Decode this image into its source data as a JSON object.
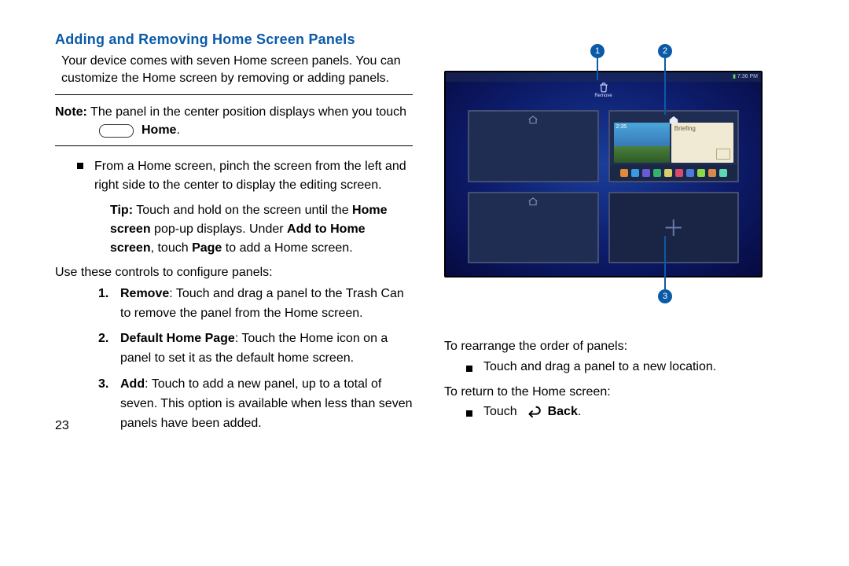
{
  "title": "Adding and Removing Home Screen Panels",
  "intro": "Your device comes with seven Home screen panels. You can customize the Home screen by removing or adding panels.",
  "note_label": "Note:",
  "note_text1": " The panel in the center position displays when you touch",
  "home_word": "Home",
  "period": ".",
  "bullet1": "From a Home screen, pinch the screen from the left and right side to the center to display the editing screen.",
  "tip_label": "Tip:",
  "tip1": " Touch and hold on the screen until the ",
  "tip_bold1": "Home screen",
  "tip2": " pop-up displays. Under ",
  "tip_bold2": "Add to Home screen",
  "tip3": ", touch ",
  "tip_bold3": "Page",
  "tip4": " to add a Home screen.",
  "configure": "Use these controls to configure panels:",
  "items": {
    "1": {
      "num": "1.",
      "bold": "Remove",
      "text": ": Touch and drag a panel to the Trash Can to remove the panel from the Home screen."
    },
    "2": {
      "num": "2.",
      "bold": "Default Home Page",
      "text": ": Touch the Home icon on a panel to set it as the default home screen."
    },
    "3": {
      "num": "3.",
      "bold": "Add",
      "text": ": Touch to add a new panel, up to a total of seven. This option is available when less than seven panels have been added."
    }
  },
  "pagenum": "23",
  "fig": {
    "status_time": "7:36 PM",
    "remove_label": "Remove",
    "weather_time": "2:35",
    "briefing": "Briefing",
    "c1": "1",
    "c2": "2",
    "c3": "3",
    "dock_colors": [
      "#e08a3a",
      "#3a9ae0",
      "#6a5ad4",
      "#34b36e",
      "#d9d06a",
      "#d94a6e",
      "#4a7bd9",
      "#8ad94a",
      "#d98a4a",
      "#5ad9b3"
    ]
  },
  "right": {
    "rearrange": "To rearrange the order of panels:",
    "rearrange_bullet": "Touch and drag a panel to a new location.",
    "return": "To return to the Home screen:",
    "touch": "Touch ",
    "back": "Back"
  }
}
